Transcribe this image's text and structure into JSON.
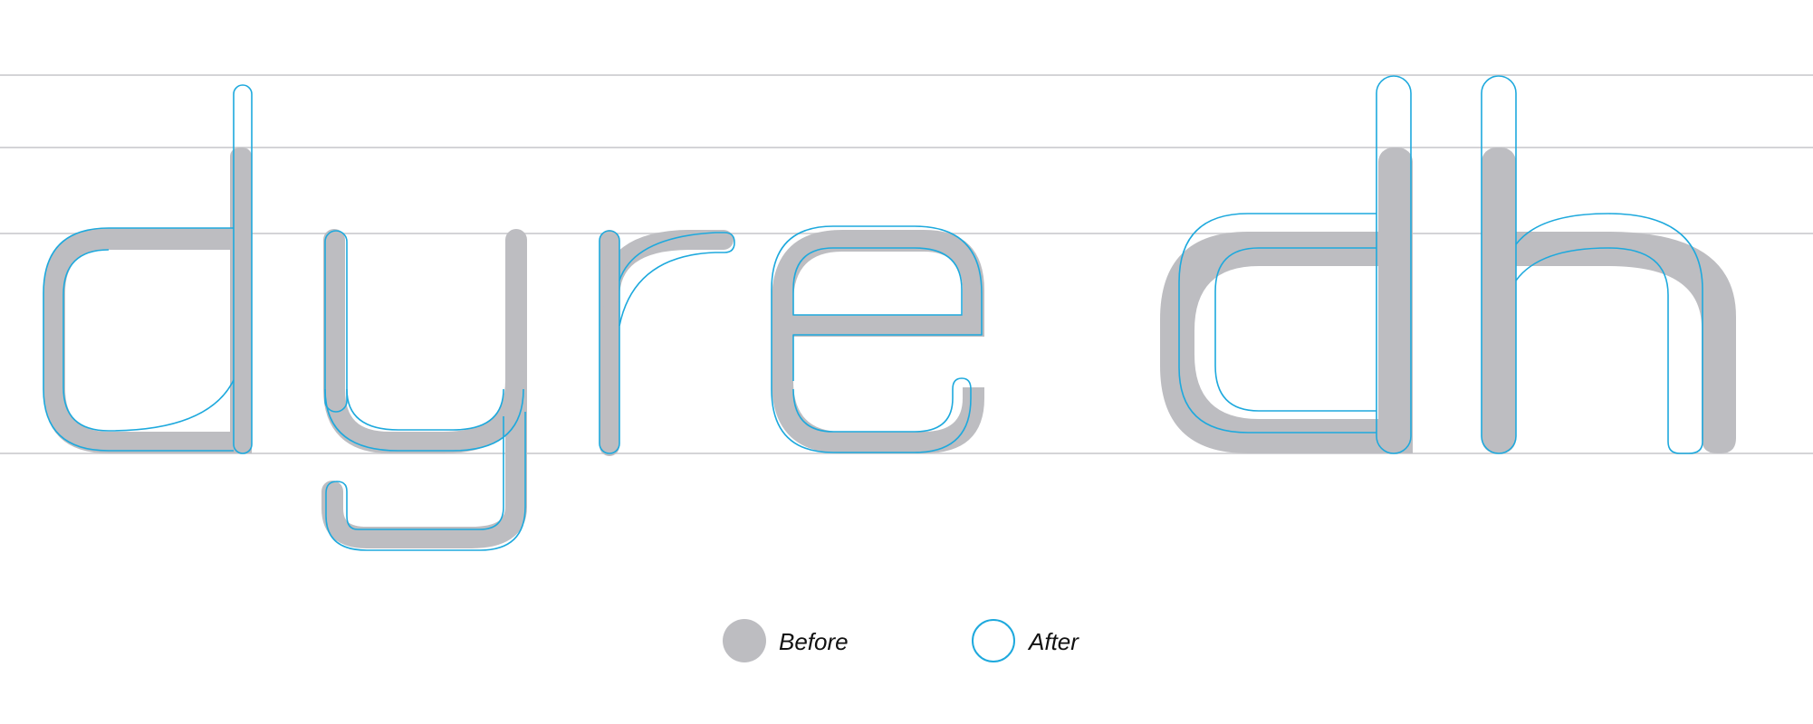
{
  "legend": {
    "before_label": "Before",
    "after_label": "After"
  },
  "colors": {
    "before_fill": "#bdbdc1",
    "after_outline": "#1ea9dd",
    "guideline": "#d4d4d7",
    "background": "#ffffff"
  },
  "glyphs": [
    "d",
    "y",
    "r",
    "e",
    "d",
    "h"
  ]
}
